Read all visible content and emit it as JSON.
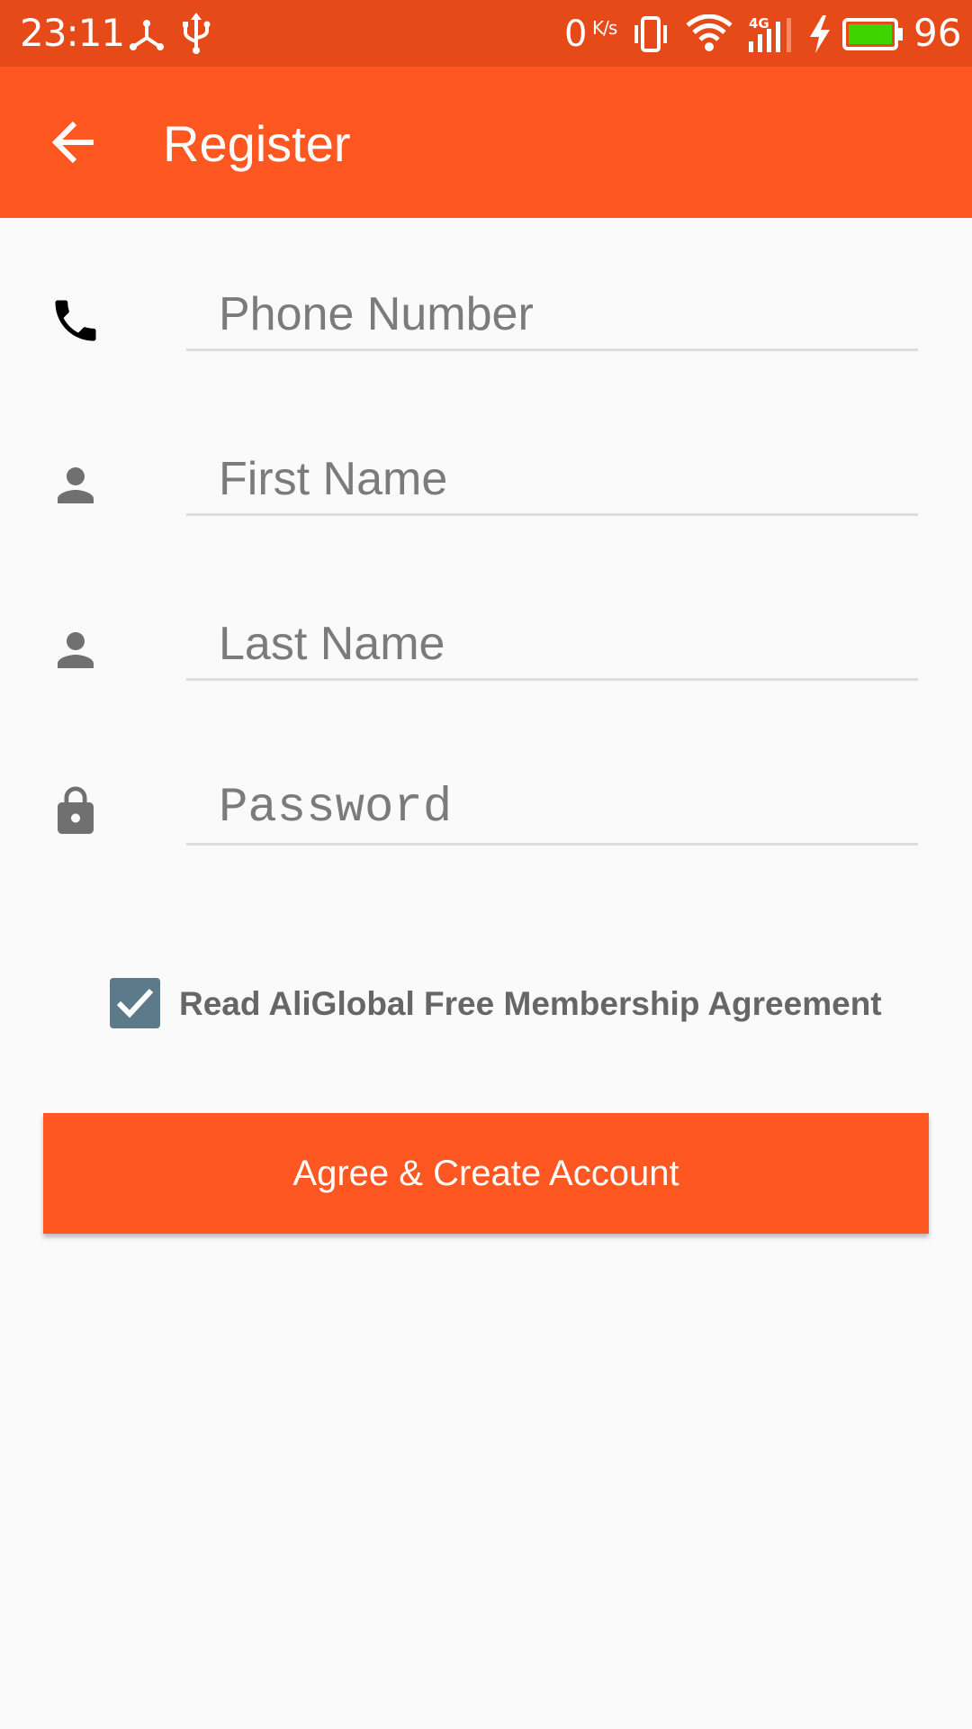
{
  "status_bar": {
    "time": "23:11",
    "network_speed_value": "0",
    "network_speed_unit": "K/s",
    "network_type": "4G",
    "battery_level": "96",
    "icons": [
      "usb-tethering-icon",
      "usb-icon",
      "vibrate-icon",
      "wifi-icon",
      "signal-icon",
      "charging-icon",
      "battery-icon"
    ]
  },
  "app_bar": {
    "title": "Register",
    "back_icon": "arrow-back-icon"
  },
  "form": {
    "fields": [
      {
        "name": "phone",
        "placeholder": "Phone Number",
        "value": "",
        "icon": "phone-icon"
      },
      {
        "name": "first_name",
        "placeholder": "First Name",
        "value": "",
        "icon": "person-icon"
      },
      {
        "name": "last_name",
        "placeholder": "Last Name",
        "value": "",
        "icon": "person-icon"
      },
      {
        "name": "password",
        "placeholder": "Password",
        "value": "",
        "icon": "lock-icon"
      }
    ]
  },
  "agreement": {
    "label": "Read AliGlobal Free Membership Agreement",
    "checked": true
  },
  "create_button": {
    "label": "Agree & Create Account"
  },
  "colors": {
    "status_bar": "#e64a19",
    "primary": "#ff5722",
    "checkbox": "#5c7a8a",
    "icon_gray": "#707070",
    "background": "#fafafa"
  }
}
